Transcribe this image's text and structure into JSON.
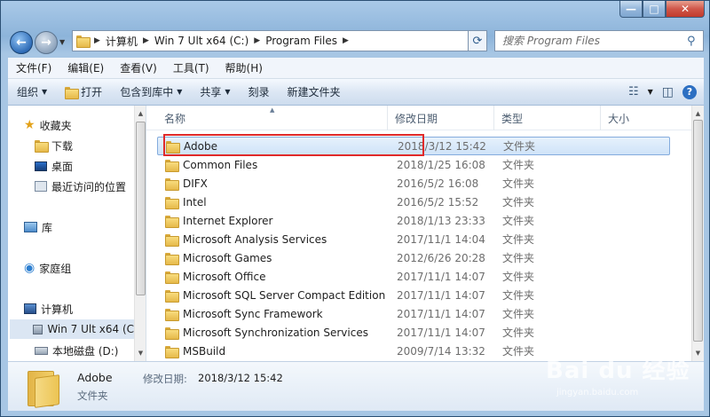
{
  "window": {
    "min_glyph": "—",
    "max_glyph": "□",
    "close_glyph": "✕"
  },
  "nav": {
    "back_glyph": "←",
    "forward_glyph": "→"
  },
  "address": {
    "crumbs": [
      "计算机",
      "Win 7 Ult x64 (C:)",
      "Program Files"
    ]
  },
  "search": {
    "placeholder": "搜索 Program Files"
  },
  "menu": [
    "文件(F)",
    "编辑(E)",
    "查看(V)",
    "工具(T)",
    "帮助(H)"
  ],
  "commands": {
    "organize": "组织",
    "open": "打开",
    "include_library": "包含到库中",
    "share": "共享",
    "burn": "刻录",
    "new_folder": "新建文件夹"
  },
  "nav_pane": {
    "favorites": "收藏夹",
    "downloads": "下载",
    "desktop": "桌面",
    "recent": "最近访问的位置",
    "libraries": "库",
    "homegroup": "家庭组",
    "computer": "计算机",
    "drive_c": "Win 7 Ult x64 (C",
    "drive_d": "本地磁盘 (D:)"
  },
  "columns": {
    "name": "名称",
    "date": "修改日期",
    "type": "类型",
    "size": "大小"
  },
  "files": [
    {
      "name": "Adobe",
      "date": "2018/3/12 15:42",
      "type": "文件夹"
    },
    {
      "name": "Common Files",
      "date": "2018/1/25 16:08",
      "type": "文件夹"
    },
    {
      "name": "DIFX",
      "date": "2016/5/2 16:08",
      "type": "文件夹"
    },
    {
      "name": "Intel",
      "date": "2016/5/2 15:52",
      "type": "文件夹"
    },
    {
      "name": "Internet Explorer",
      "date": "2018/1/13 23:33",
      "type": "文件夹"
    },
    {
      "name": "Microsoft Analysis Services",
      "date": "2017/11/1 14:04",
      "type": "文件夹"
    },
    {
      "name": "Microsoft Games",
      "date": "2012/6/26 20:28",
      "type": "文件夹"
    },
    {
      "name": "Microsoft Office",
      "date": "2017/11/1 14:07",
      "type": "文件夹"
    },
    {
      "name": "Microsoft SQL Server Compact Edition",
      "date": "2017/11/1 14:07",
      "type": "文件夹"
    },
    {
      "name": "Microsoft Sync Framework",
      "date": "2017/11/1 14:07",
      "type": "文件夹"
    },
    {
      "name": "Microsoft Synchronization Services",
      "date": "2017/11/1 14:07",
      "type": "文件夹"
    },
    {
      "name": "MSBuild",
      "date": "2009/7/14 13:32",
      "type": "文件夹"
    }
  ],
  "details": {
    "name": "Adobe",
    "date_label": "修改日期:",
    "date_value": "2018/3/12 15:42",
    "type": "文件夹"
  },
  "watermark": {
    "logo": "Bai du 经验",
    "sub": "jingyan.baidu.com"
  }
}
